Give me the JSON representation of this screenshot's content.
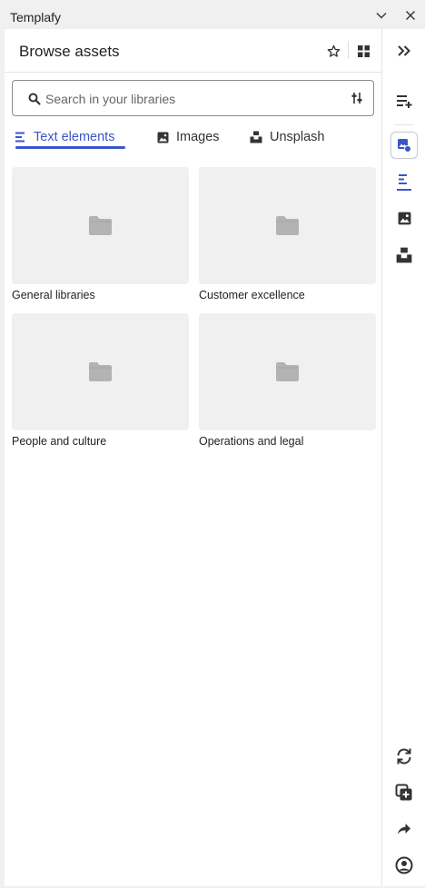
{
  "app": {
    "title": "Templafy"
  },
  "header": {
    "title": "Browse assets"
  },
  "search": {
    "placeholder": "Search in your libraries",
    "value": ""
  },
  "tabs": [
    {
      "label": "Text elements",
      "icon": "text-lines-icon",
      "active": true
    },
    {
      "label": "Images",
      "icon": "image-icon",
      "active": false
    },
    {
      "label": "Unsplash",
      "icon": "unsplash-icon",
      "active": false
    }
  ],
  "libraries": [
    {
      "label": "General libraries",
      "icon": "folder-icon"
    },
    {
      "label": "Customer excellence",
      "icon": "folder-icon"
    },
    {
      "label": "People and culture",
      "icon": "folder-icon"
    },
    {
      "label": "Operations and legal",
      "icon": "folder-icon"
    }
  ],
  "rail": {
    "top": [
      "expand-icon",
      "insert-text-icon",
      "browse-assets-icon",
      "text-elements-icon",
      "images-icon",
      "unsplash-icon"
    ],
    "bottom": [
      "refresh-icon",
      "add-copy-icon",
      "share-icon",
      "account-icon"
    ]
  },
  "colors": {
    "accent": "#3b55c9",
    "thumb_bg": "#f0f0f0",
    "folder": "#b3b3b3"
  }
}
